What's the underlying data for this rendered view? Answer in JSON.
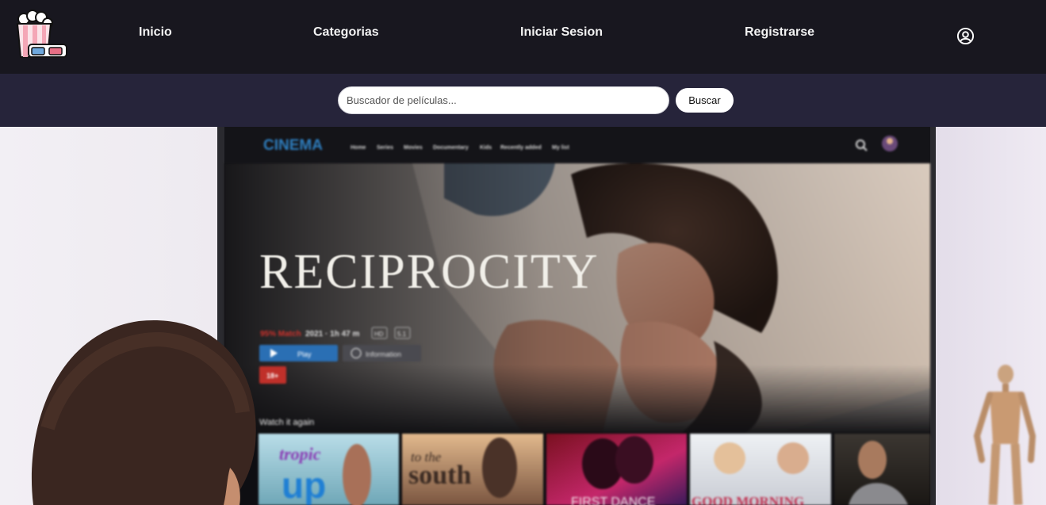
{
  "nav": {
    "items": [
      {
        "label": "Inicio"
      },
      {
        "label": "Categorias"
      },
      {
        "label": "Iniciar Sesion"
      },
      {
        "label": "Registrarse"
      }
    ],
    "logo_icon": "popcorn-3d-glasses-icon",
    "user_icon": "user-circle-icon"
  },
  "search": {
    "placeholder": "Buscador de películas...",
    "value": "",
    "button_label": "Buscar"
  },
  "hero": {
    "tv": {
      "brand": "CINEMA",
      "menu": [
        "Home",
        "Series",
        "Movies",
        "Documentary",
        "Kids",
        "Recently added",
        "My list"
      ],
      "featured_title": "RECIPROCITY",
      "match": "95% Match",
      "meta": "2021 · 1h 47 m",
      "badges": [
        "HD",
        "5.1"
      ],
      "play_label": "Play",
      "info_label": "Information",
      "rating": "18+",
      "row_title": "Watch it again",
      "thumbnails": [
        {
          "line1": "tropic",
          "line2": "up"
        },
        {
          "line1": "to the",
          "line2": "south"
        },
        {
          "line1": "FIRST DANCE",
          "line2": ""
        },
        {
          "line1": "GOOD MORNING",
          "line2": ""
        },
        {
          "line1": "",
          "line2": ""
        }
      ]
    },
    "colors": {
      "wall": "#e9e6ee",
      "tv_screen": "#0e0e12",
      "brand": "#2f7fc0",
      "accent_red": "#c0302a",
      "play_blue": "#2a6fb4"
    }
  }
}
